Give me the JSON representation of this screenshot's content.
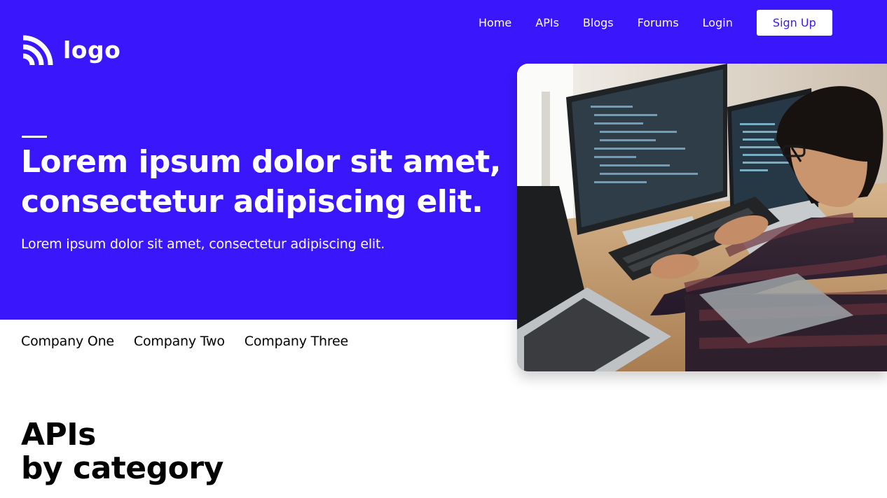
{
  "brand": {
    "logo_text": "logo",
    "accent_color": "#3a16fc",
    "logo_icon": "wifi-signal-icon"
  },
  "nav": {
    "items": [
      {
        "label": "Home"
      },
      {
        "label": "APIs"
      },
      {
        "label": "Blogs"
      },
      {
        "label": "Forums"
      },
      {
        "label": "Login"
      }
    ],
    "signup_label": "Sign Up"
  },
  "hero": {
    "headline_line1": "Lorem ipsum dolor sit amet,",
    "headline_line2": "consectetur adipiscing elit.",
    "subheadline": "Lorem ipsum dolor sit amet, consectetur adipiscing elit.",
    "image_subject": "developer-at-computer-photo"
  },
  "companies": [
    {
      "name": "Company One"
    },
    {
      "name": "Company Two"
    },
    {
      "name": "Company Three"
    }
  ],
  "section": {
    "title_line1": "APIs",
    "title_line2": "by category"
  }
}
